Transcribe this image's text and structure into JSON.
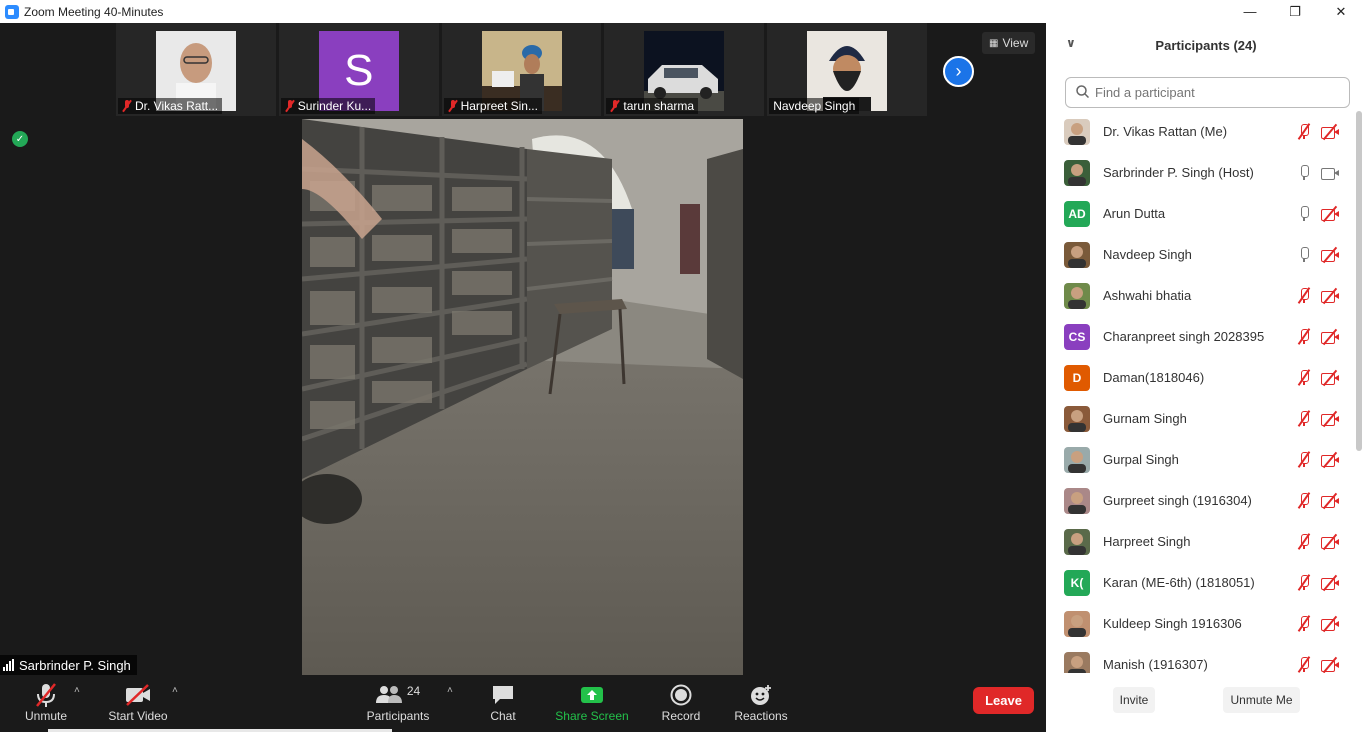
{
  "window": {
    "title": "Zoom Meeting 40-Minutes",
    "min": "—",
    "max": "❐",
    "close": "✕"
  },
  "view_label": "View",
  "thumbnails": [
    {
      "name": "Dr. Vikas Ratt...",
      "muted": true
    },
    {
      "name": "Surinder Ku...",
      "muted": true,
      "initial": "S",
      "color": "#8a3fbf"
    },
    {
      "name": "Harpreet Sin...",
      "muted": true
    },
    {
      "name": "tarun sharma",
      "muted": true
    },
    {
      "name": "Navdeep Singh",
      "muted": false
    }
  ],
  "active_speaker": "Sarbrinder P. Singh",
  "toolbar": {
    "unmute": "Unmute",
    "start_video": "Start Video",
    "participants": "Participants",
    "participants_count": "24",
    "chat": "Chat",
    "share_screen": "Share Screen",
    "record": "Record",
    "reactions": "Reactions",
    "leave": "Leave"
  },
  "panel": {
    "title": "Participants (24)",
    "search_placeholder": "Find a participant",
    "invite": "Invite",
    "unmute_me": "Unmute Me",
    "participants": [
      {
        "name": "Dr. Vikas Rattan (Me)",
        "avatar": "photo",
        "mic": "off",
        "cam": "off"
      },
      {
        "name": "Sarbrinder P. Singh (Host)",
        "avatar": "photo",
        "mic": "on",
        "cam": "on"
      },
      {
        "name": "Arun Dutta",
        "avatar": "AD",
        "color": "#23a857",
        "mic": "on",
        "cam": "off"
      },
      {
        "name": "Navdeep Singh",
        "avatar": "photo",
        "mic": "on",
        "cam": "off"
      },
      {
        "name": "Ashwahi bhatia",
        "avatar": "photo",
        "mic": "off",
        "cam": "off"
      },
      {
        "name": "Charanpreet singh 2028395",
        "avatar": "CS",
        "color": "#8a3fbf",
        "mic": "off",
        "cam": "off"
      },
      {
        "name": "Daman(1818046)",
        "avatar": "D",
        "color": "#e05a00",
        "mic": "off",
        "cam": "off"
      },
      {
        "name": "Gurnam Singh",
        "avatar": "photo",
        "mic": "off",
        "cam": "off"
      },
      {
        "name": "Gurpal Singh",
        "avatar": "photo",
        "mic": "off",
        "cam": "off"
      },
      {
        "name": "Gurpreet singh (1916304)",
        "avatar": "photo",
        "mic": "off",
        "cam": "off"
      },
      {
        "name": "Harpreet Singh",
        "avatar": "photo",
        "mic": "off",
        "cam": "off"
      },
      {
        "name": "Karan (ME-6th) (1818051)",
        "avatar": "K(",
        "color": "#23a857",
        "mic": "off",
        "cam": "off"
      },
      {
        "name": "Kuldeep Singh 1916306",
        "avatar": "photo",
        "mic": "off",
        "cam": "off"
      },
      {
        "name": "Manish (1916307)",
        "avatar": "photo",
        "mic": "off",
        "cam": "off"
      }
    ]
  },
  "colors": {
    "leave": "#e02828",
    "share": "#23c14a",
    "accent": "#1b74e8",
    "mute": "#e02828"
  }
}
